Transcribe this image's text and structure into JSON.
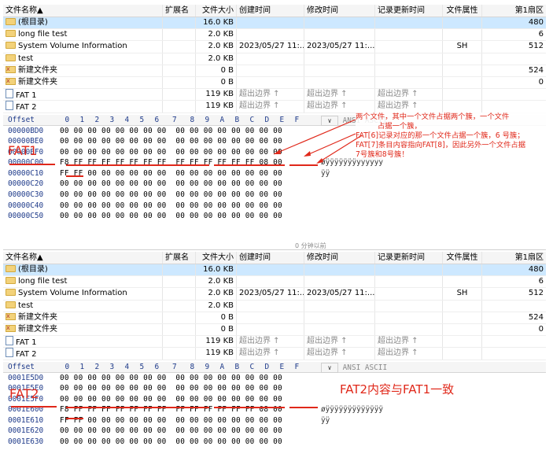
{
  "columns": {
    "name": "文件名称",
    "ext": "扩展名",
    "size": "文件大小",
    "created": "创建时间",
    "modified": "修改时间",
    "record_updated": "记录更新时间",
    "attr": "文件属性",
    "first_sector": "第1扇区"
  },
  "files": [
    {
      "name": "(根目录)",
      "size": "16.0 KB",
      "created": "",
      "modified": "",
      "record_updated": "",
      "attr": "",
      "sector": "480",
      "icon": "folder-icon"
    },
    {
      "name": "long file test",
      "size": "2.0 KB",
      "created": "",
      "modified": "",
      "record_updated": "",
      "attr": "",
      "sector": "6",
      "icon": "folder-icon"
    },
    {
      "name": "System Volume Information",
      "size": "2.0 KB",
      "created": "2023/05/27  11:...",
      "modified": "2023/05/27  11:...",
      "record_updated": "",
      "attr": "SH",
      "sector": "512",
      "icon": "folder-icon"
    },
    {
      "name": "test",
      "size": "2.0 KB",
      "created": "",
      "modified": "",
      "record_updated": "",
      "attr": "",
      "sector": "",
      "icon": "folder-icon"
    },
    {
      "name": "新建文件夹",
      "size": "0 B",
      "created": "",
      "modified": "",
      "record_updated": "",
      "attr": "",
      "sector": "524",
      "icon": "deleted-folder-icon"
    },
    {
      "name": "新建文件夹",
      "size": "0 B",
      "created": "",
      "modified": "",
      "record_updated": "",
      "attr": "",
      "sector": "0",
      "icon": "deleted-folder-icon"
    },
    {
      "name": "FAT 1",
      "size": "119 KB",
      "created": "超出边界 ↑",
      "modified": "超出边界 ↑",
      "record_updated": "超出边界 ↑",
      "attr": "",
      "sector": "",
      "icon": "document-icon"
    },
    {
      "name": "FAT 2",
      "size": "119 KB",
      "created": "超出边界 ↑",
      "modified": "超出边界 ↑",
      "record_updated": "超出边界 ↑",
      "attr": "",
      "sector": "",
      "icon": "document-icon"
    }
  ],
  "hex_header": {
    "offset": "Offset",
    "cols": [
      "0",
      "1",
      "2",
      "3",
      "4",
      "5",
      "6",
      "7",
      "8",
      "9",
      "A",
      "B",
      "C",
      "D",
      "E",
      "F"
    ],
    "ctrl": "∨",
    "ansi": "ANSI ASCII"
  },
  "panel1": {
    "rows": [
      {
        "offset": "00000BD0",
        "bytes": "00 00 00 00 00 00 00 00  00 00 00 00 00 00 00 00",
        "ascii": ""
      },
      {
        "offset": "00000BE0",
        "bytes": "00 00 00 00 00 00 00 00  00 00 00 00 00 00 00 00",
        "ascii": ""
      },
      {
        "offset": "00000BF0",
        "bytes": "00 00 00 00 00 00 00 00  00 00 00 00 00 00 00 00",
        "ascii": ""
      },
      {
        "offset": "00000C00",
        "bytes": "F8 FF FF FF FF FF FF FF  FF FF FF FF FF FF 08 00",
        "ascii": "øÿÿÿÿÿÿÿÿÿÿÿÿÿ"
      },
      {
        "offset": "00000C10",
        "bytes": "FF FF 00 00 00 00 00 00  00 00 00 00 00 00 00 00",
        "ascii": "ÿÿ"
      },
      {
        "offset": "00000C20",
        "bytes": "00 00 00 00 00 00 00 00  00 00 00 00 00 00 00 00",
        "ascii": ""
      },
      {
        "offset": "00000C30",
        "bytes": "00 00 00 00 00 00 00 00  00 00 00 00 00 00 00 00",
        "ascii": ""
      },
      {
        "offset": "00000C40",
        "bytes": "00 00 00 00 00 00 00 00  00 00 00 00 00 00 00 00",
        "ascii": ""
      },
      {
        "offset": "00000C50",
        "bytes": "00 00 00 00 00 00 00 00  00 00 00 00 00 00 00 00",
        "ascii": ""
      }
    ],
    "label": "FAT1",
    "note_lines": [
      "两个文件，其中一个文件占据两个簇，一个文件",
      "占据一个簇，",
      "FAT[6]记录对应的那一个文件占据一个簇，6 号簇；",
      "FAT[7]条目内容指向FAT[8]，因此另外一个文件占据",
      "7号簇和8号簇！"
    ]
  },
  "panel2": {
    "caption": "0 分钟以前",
    "rows": [
      {
        "offset": "0001E5D0",
        "bytes": "00 00 00 00 00 00 00 00  00 00 00 00 00 00 00 00",
        "ascii": ""
      },
      {
        "offset": "0001E5E0",
        "bytes": "00 00 00 00 00 00 00 00  00 00 00 00 00 00 00 00",
        "ascii": ""
      },
      {
        "offset": "0001E5F0",
        "bytes": "00 00 00 00 00 00 00 00  00 00 00 00 00 00 00 00",
        "ascii": ""
      },
      {
        "offset": "0001E600",
        "bytes": "F8 FF FF FF FF FF FF FF  FF FF FF FF FF FF 08 00",
        "ascii": "øÿÿÿÿÿÿÿÿÿÿÿÿÿ"
      },
      {
        "offset": "0001E610",
        "bytes": "FF FF 00 00 00 00 00 00  00 00 00 00 00 00 00 00",
        "ascii": "ÿÿ"
      },
      {
        "offset": "0001E620",
        "bytes": "00 00 00 00 00 00 00 00  00 00 00 00 00 00 00 00",
        "ascii": ""
      },
      {
        "offset": "0001E630",
        "bytes": "00 00 00 00 00 00 00 00  00 00 00 00 00 00 00 00",
        "ascii": ""
      }
    ],
    "label": "FAT2",
    "note": "FAT2内容与FAT1一致"
  },
  "colors": {
    "annotation": "#e0281a",
    "selected_row": "#cde8ff",
    "hex_blue": "#1f3b8a"
  }
}
